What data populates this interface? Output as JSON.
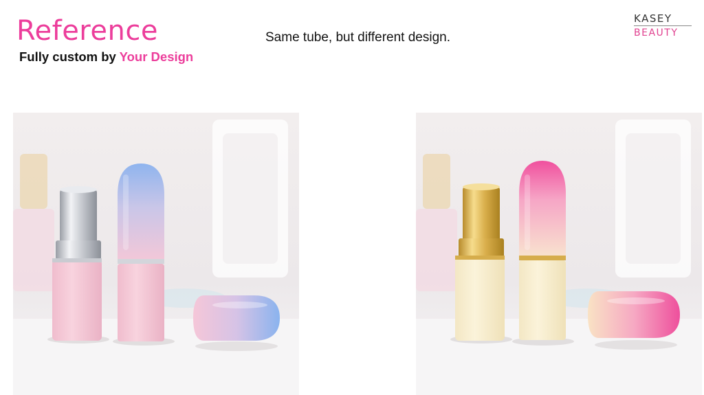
{
  "header": {
    "title": "Reference",
    "subtitle_prefix": "Fully custom by ",
    "subtitle_highlight": "Your Design",
    "caption": "Same tube, but different design."
  },
  "logo": {
    "line1": "KASEY",
    "line2": "BEAUTY"
  },
  "colors": {
    "accent_pink": "#ec3d9b",
    "text": "#111111"
  },
  "photos": [
    {
      "id": "original-design",
      "variant": "pink-blue gradient, silver inner tube"
    },
    {
      "id": "custom-design",
      "variant": "cream-pink gradient, gold inner tube"
    }
  ]
}
